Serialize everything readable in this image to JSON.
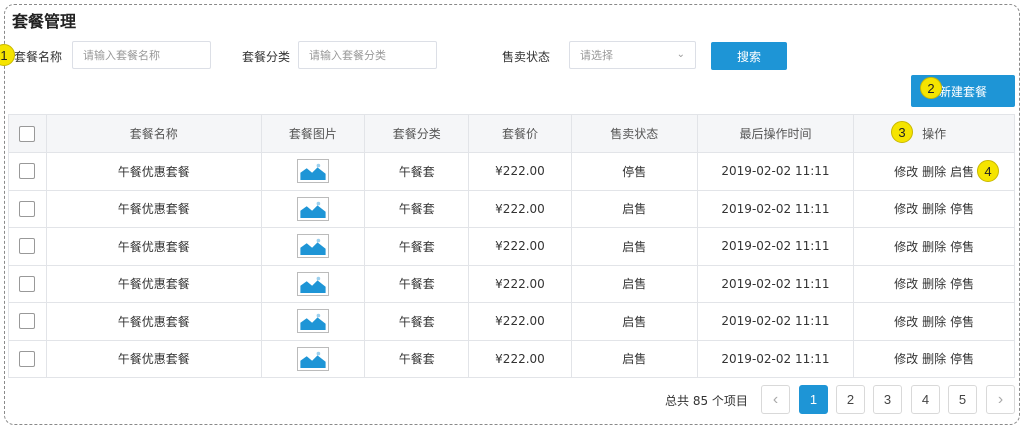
{
  "page": {
    "title": "套餐管理"
  },
  "filters": {
    "name_label": "套餐名称",
    "name_placeholder": "请输入套餐名称",
    "category_label": "套餐分类",
    "category_placeholder": "请输入套餐分类",
    "status_label": "售卖状态",
    "status_placeholder": "请选择",
    "search_label": "搜索"
  },
  "toolbar": {
    "new_label": "新建套餐"
  },
  "markers": [
    "1",
    "2",
    "3",
    "4"
  ],
  "table": {
    "columns": [
      "套餐名称",
      "套餐图片",
      "套餐分类",
      "套餐价",
      "售卖状态",
      "最后操作时间",
      "操作"
    ],
    "rows": [
      {
        "name": "午餐优惠套餐",
        "category": "午餐套",
        "price": "¥222.00",
        "status": "停售",
        "time": "2019-02-02 11:11",
        "edit": "修改",
        "delete": "删除",
        "toggle": "启售"
      },
      {
        "name": "午餐优惠套餐",
        "category": "午餐套",
        "price": "¥222.00",
        "status": "启售",
        "time": "2019-02-02 11:11",
        "edit": "修改",
        "delete": "删除",
        "toggle": "停售"
      },
      {
        "name": "午餐优惠套餐",
        "category": "午餐套",
        "price": "¥222.00",
        "status": "启售",
        "time": "2019-02-02 11:11",
        "edit": "修改",
        "delete": "删除",
        "toggle": "停售"
      },
      {
        "name": "午餐优惠套餐",
        "category": "午餐套",
        "price": "¥222.00",
        "status": "启售",
        "time": "2019-02-02 11:11",
        "edit": "修改",
        "delete": "删除",
        "toggle": "停售"
      },
      {
        "name": "午餐优惠套餐",
        "category": "午餐套",
        "price": "¥222.00",
        "status": "启售",
        "time": "2019-02-02 11:11",
        "edit": "修改",
        "delete": "删除",
        "toggle": "停售"
      },
      {
        "name": "午餐优惠套餐",
        "category": "午餐套",
        "price": "¥222.00",
        "status": "启售",
        "time": "2019-02-02 11:11",
        "edit": "修改",
        "delete": "删除",
        "toggle": "停售"
      }
    ]
  },
  "pagination": {
    "total_label": "总共 85 个项目",
    "prev_icon": "chevron-left-icon",
    "next_icon": "chevron-right-icon",
    "pages": [
      "1",
      "2",
      "3",
      "4",
      "5"
    ],
    "current": "1"
  },
  "colors": {
    "primary": "#1e95d6",
    "marker": "#f5e400"
  }
}
